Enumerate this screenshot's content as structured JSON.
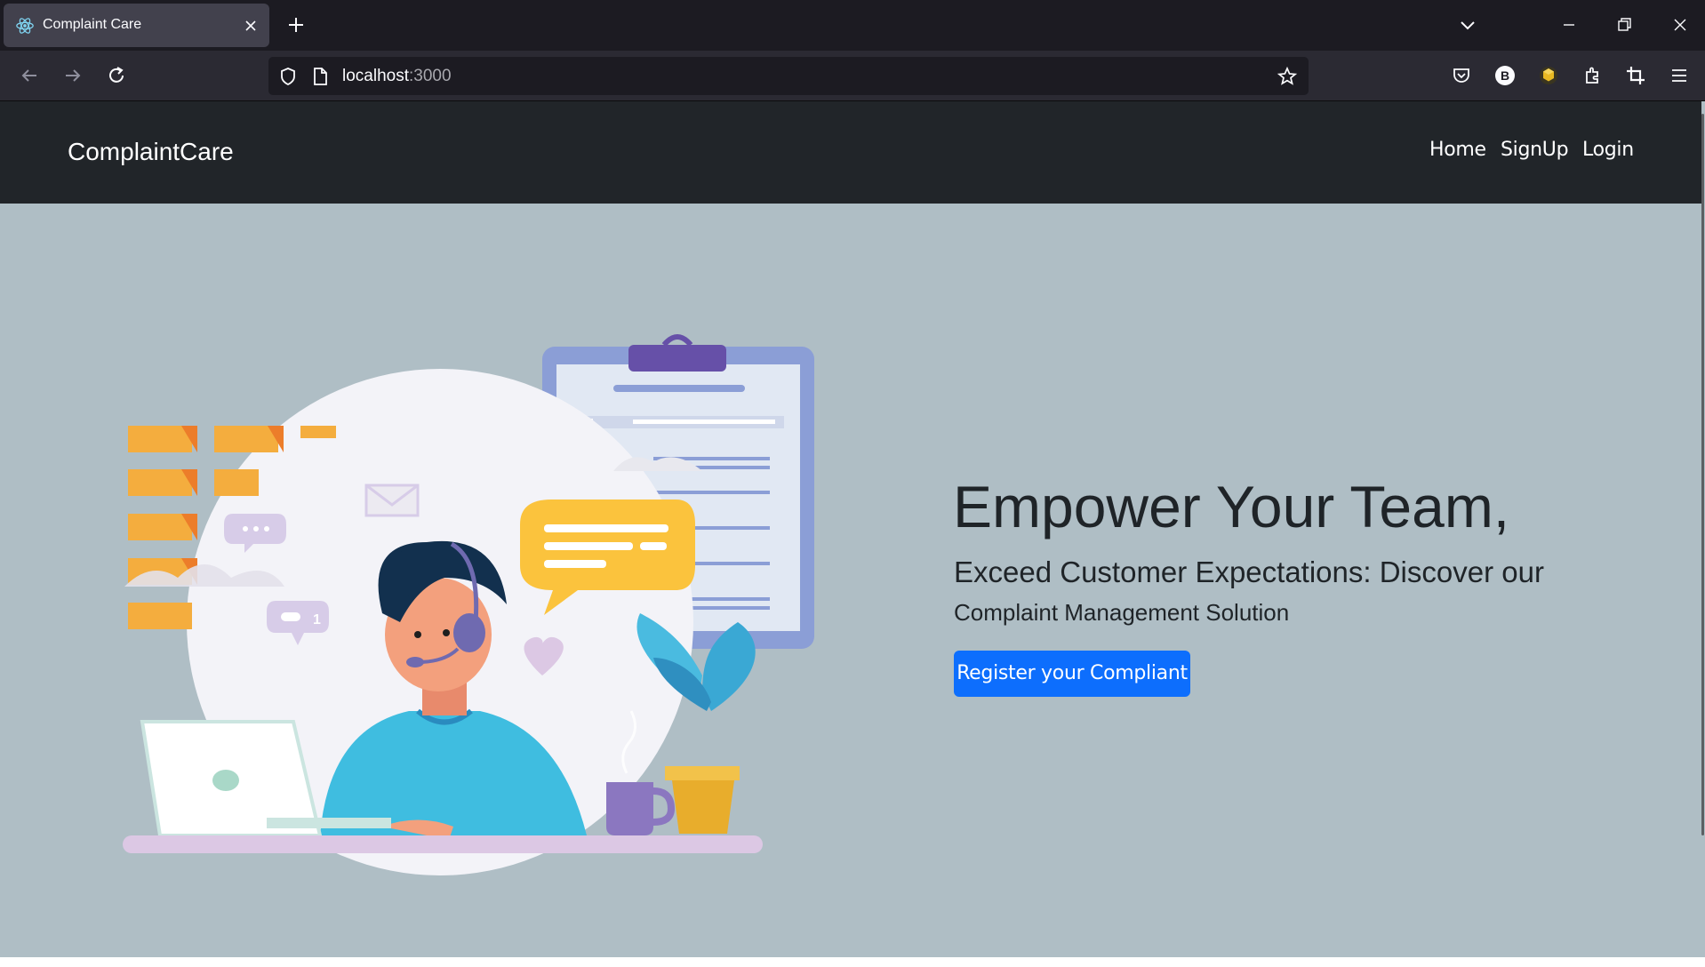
{
  "browser": {
    "tab": {
      "title": "Complaint Care",
      "favicon": "react-icon"
    },
    "url": {
      "host": "localhost",
      "port": ":3000"
    },
    "icons": [
      "back-icon",
      "forward-icon",
      "reload-icon",
      "shield-icon",
      "page-icon",
      "star-icon",
      "pocket-icon",
      "b-extension-icon",
      "cube-extension-icon",
      "extensions-icon",
      "crop-icon",
      "menu-icon"
    ]
  },
  "site": {
    "brand": "ComplaintCare",
    "nav": {
      "home": "Home",
      "signup": "SignUp",
      "login": "Login"
    },
    "hero": {
      "title": "Empower Your Team,",
      "subtitle_line1": "Exceed Customer Expectations: Discover our",
      "subtitle_line2": "Complaint Management Solution",
      "cta": "Register your Compliant",
      "illustration_badge": "1"
    }
  },
  "colors": {
    "page_bg": "#afbec5",
    "nav_bg": "#212529",
    "cta_bg": "#0d6efd",
    "browser_tabstrip": "#1c1b22",
    "browser_toolbar": "#2b2a33"
  }
}
